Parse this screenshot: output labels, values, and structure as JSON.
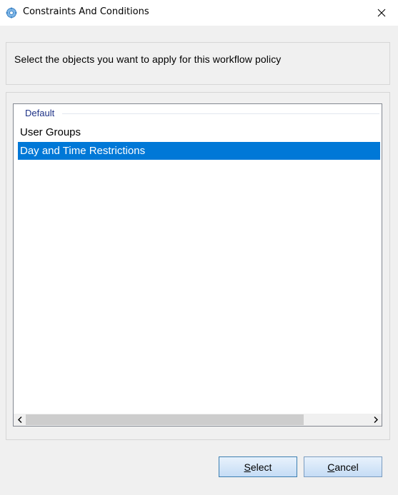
{
  "window": {
    "title": "Constraints And Conditions",
    "icon": "gear-icon",
    "close_icon": "close-icon"
  },
  "instruction": "Select the objects you want to apply for this workflow policy",
  "list": {
    "group_label": "Default",
    "items": [
      {
        "label": "User Groups",
        "selected": false
      },
      {
        "label": "Day and Time Restrictions",
        "selected": true
      }
    ]
  },
  "buttons": {
    "select_mnemonic": "S",
    "select_rest": "elect",
    "cancel_mnemonic": "C",
    "cancel_rest": "ancel"
  },
  "colors": {
    "selection": "#0078d7",
    "group_header": "#1e3287"
  }
}
